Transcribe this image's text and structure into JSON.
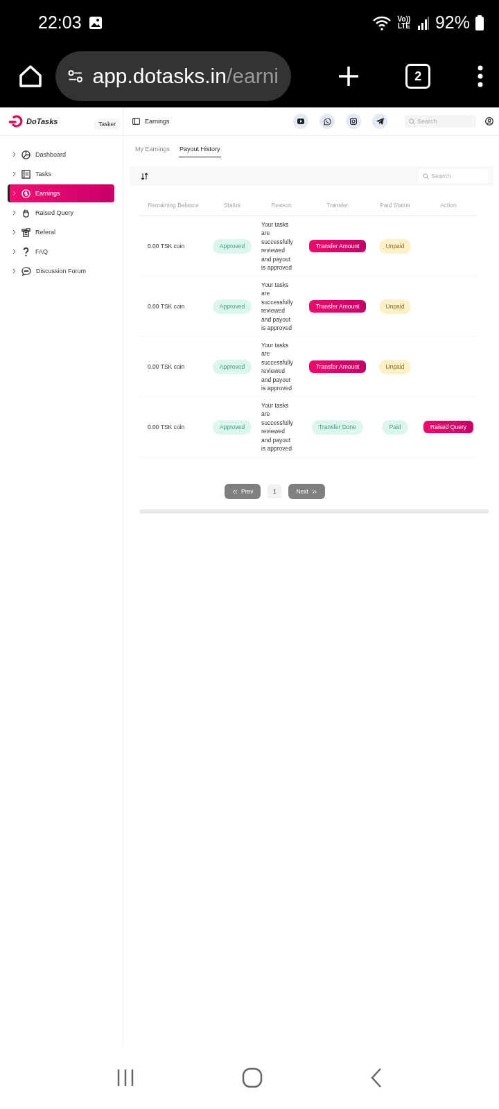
{
  "status_bar": {
    "time": "22:03",
    "network": "Vo)) LTE",
    "battery": "92%"
  },
  "browser": {
    "url_host": "app.dotasks.in",
    "url_path": "/earni",
    "tab_count": "2"
  },
  "sidebar": {
    "logo": "DoTasks",
    "role": "Tasker",
    "items": [
      {
        "label": "Dashboard",
        "selected": false
      },
      {
        "label": "Tasks",
        "selected": false
      },
      {
        "label": "Earnings",
        "selected": true
      },
      {
        "label": "Raised Query",
        "selected": false
      },
      {
        "label": "Referal",
        "selected": false
      },
      {
        "label": "FAQ",
        "selected": false
      },
      {
        "label": "Discussion Forum",
        "selected": false
      }
    ]
  },
  "header": {
    "title": "Earnings",
    "search": {
      "placeholder": "Search"
    }
  },
  "tabs": [
    {
      "label": "My Earnings",
      "selected": false
    },
    {
      "label": "Payout History",
      "selected": true
    }
  ],
  "toolbar": {
    "search": {
      "placeholder": "Search"
    }
  },
  "table": {
    "columns": [
      "Remaining Balance",
      "Status",
      "Reason",
      "Transfer",
      "Paid Status",
      "Action"
    ],
    "rows": [
      {
        "balance": "0.00 TSK coin",
        "status": {
          "label": "Approved",
          "kind": "success"
        },
        "reason": "Your tasks are successfully reviewed and payout is approved",
        "transfer": {
          "label": "Transfer Amount",
          "kind": "button"
        },
        "paid_status": {
          "label": "Unpaid",
          "kind": "warning"
        }
      },
      {
        "balance": "0.00 TSK coin",
        "status": {
          "label": "Approved",
          "kind": "success"
        },
        "reason": "Your tasks are successfully reviewed and payout is approved",
        "transfer": {
          "label": "Transfer Amount",
          "kind": "button"
        },
        "paid_status": {
          "label": "Unpaid",
          "kind": "warning"
        }
      },
      {
        "balance": "0.00 TSK coin",
        "status": {
          "label": "Approved",
          "kind": "success"
        },
        "reason": "Your tasks are successfully reviewed and payout is approved",
        "transfer": {
          "label": "Transfer Amount",
          "kind": "button"
        },
        "paid_status": {
          "label": "Unpaid",
          "kind": "warning"
        }
      },
      {
        "balance": "0.00 TSK coin",
        "status": {
          "label": "Approved",
          "kind": "success"
        },
        "reason": "Your tasks are successfully reviewed and payout is approved",
        "transfer": {
          "label": "Transfer Done",
          "kind": "badge"
        },
        "paid_status": {
          "label": "Paid",
          "kind": "success"
        },
        "action": "Raised Query"
      }
    ]
  },
  "pagination": {
    "prev": "Prev",
    "page": "1",
    "next": "Next"
  }
}
